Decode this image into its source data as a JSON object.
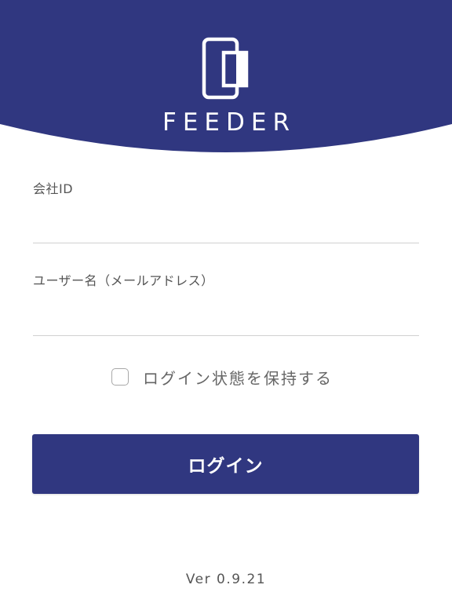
{
  "colors": {
    "brand": "#303780",
    "background": "#ffffff",
    "divider": "#d0d0d0"
  },
  "header": {
    "logo_icon": "phone-card-icon",
    "brand_name": "FEEDER"
  },
  "form": {
    "company_id_label": "会社ID",
    "company_id_value": "",
    "username_label": "ユーザー名（メールアドレス）",
    "username_value": "",
    "remember_label": "ログイン状態を保持する",
    "remember_checked": false,
    "login_button_label": "ログイン"
  },
  "footer": {
    "version": "Ver 0.9.21"
  }
}
